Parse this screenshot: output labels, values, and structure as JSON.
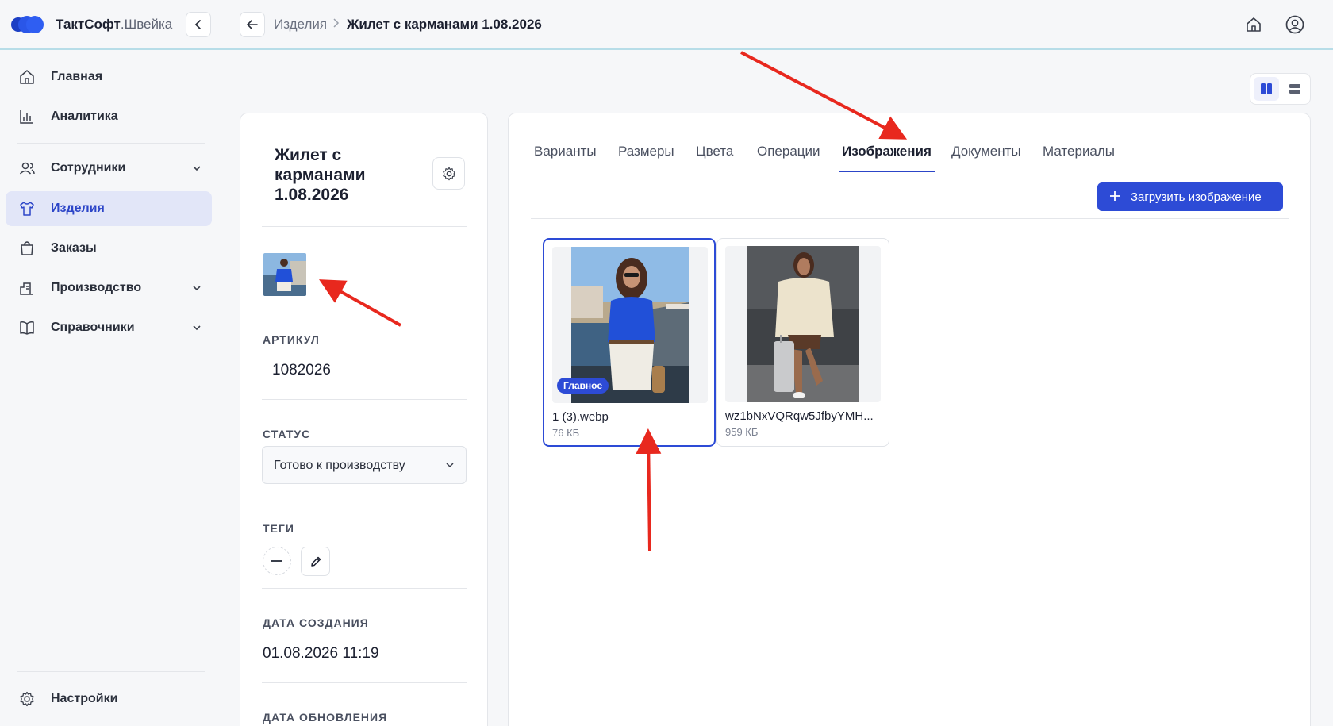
{
  "brand": {
    "name_bold": "ТактСофт",
    "name_light": ".Швейка"
  },
  "breadcrumb": {
    "parent": "Изделия",
    "current": "Жилет с карманами 1.08.2026"
  },
  "sidebar": {
    "items": [
      {
        "label": "Главная",
        "icon": "home-icon"
      },
      {
        "label": "Аналитика",
        "icon": "chart-icon"
      },
      {
        "label": "Сотрудники",
        "icon": "users-icon"
      },
      {
        "label": "Изделия",
        "icon": "shirt-icon"
      },
      {
        "label": "Заказы",
        "icon": "bag-icon"
      },
      {
        "label": "Производство",
        "icon": "factory-icon"
      },
      {
        "label": "Справочники",
        "icon": "book-icon"
      }
    ],
    "settings": "Настройки"
  },
  "product": {
    "title": "Жилет с карманами 1.08.2026",
    "article_label": "АРТИКУЛ",
    "article": "1082026",
    "status_label": "СТАТУС",
    "status": "Готово к производству",
    "tags_label": "ТЕГИ",
    "created_label": "ДАТА СОЗДАНИЯ",
    "created": "01.08.2026 11:19",
    "updated_label": "ДАТА ОБНОВЛЕНИЯ"
  },
  "tabs": [
    {
      "label": "Варианты"
    },
    {
      "label": "Размеры"
    },
    {
      "label": "Цвета"
    },
    {
      "label": "Операции"
    },
    {
      "label": "Изображения"
    },
    {
      "label": "Документы"
    },
    {
      "label": "Материалы"
    }
  ],
  "active_tab": "Изображения",
  "upload_button": "Загрузить изображение",
  "images": [
    {
      "name": "1 (3).webp",
      "size": "76 КБ",
      "badge": "Главное"
    },
    {
      "name": "wz1bNxVQRqw5JfbyYMH...",
      "size": "959 КБ"
    }
  ],
  "colors": {
    "accent": "#2d4bd6",
    "annotation": "#e8281e"
  }
}
